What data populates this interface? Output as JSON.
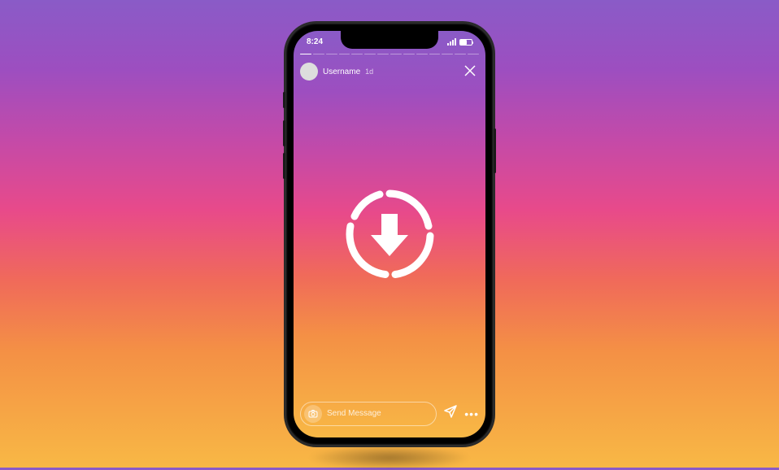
{
  "statusBar": {
    "time": "8:24"
  },
  "story": {
    "username": "Username",
    "timestamp": "1d",
    "messagePlaceholder": "Send Message",
    "segments": 14
  }
}
